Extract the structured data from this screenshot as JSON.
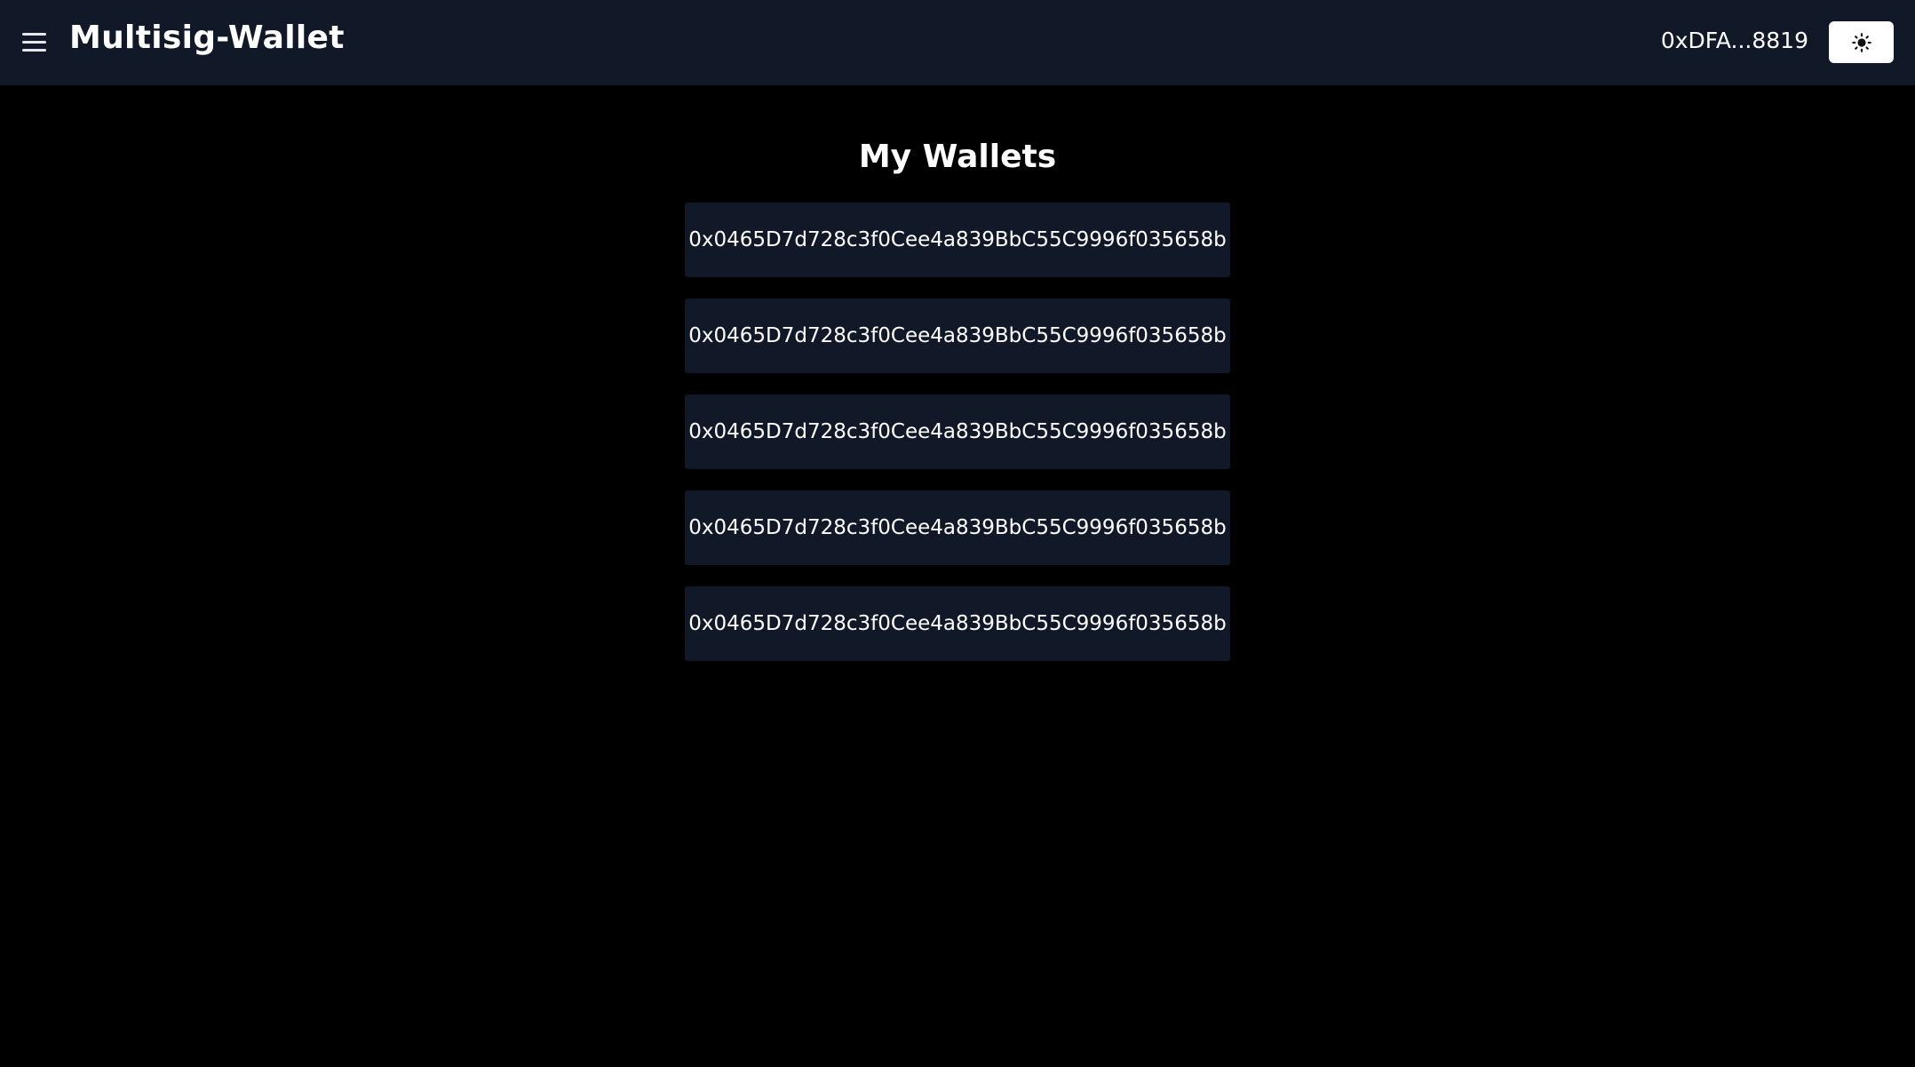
{
  "header": {
    "title": "Multisig-Wallet",
    "account_address": "0xDFA...8819",
    "menu_icon": "hamburger-menu-icon",
    "theme_icon": "sun-icon"
  },
  "main": {
    "heading": "My Wallets",
    "wallets": [
      "0x0465D7d728c3f0Cee4a839BbC55C9996f035658b",
      "0x0465D7d728c3f0Cee4a839BbC55C9996f035658b",
      "0x0465D7d728c3f0Cee4a839BbC55C9996f035658b",
      "0x0465D7d728c3f0Cee4a839BbC55C9996f035658b",
      "0x0465D7d728c3f0Cee4a839BbC55C9996f035658b"
    ]
  },
  "colors": {
    "background": "#000000",
    "header_background": "#111827",
    "card_background": "#111827",
    "text": "#ffffff",
    "theme_button": "#ffffff"
  }
}
